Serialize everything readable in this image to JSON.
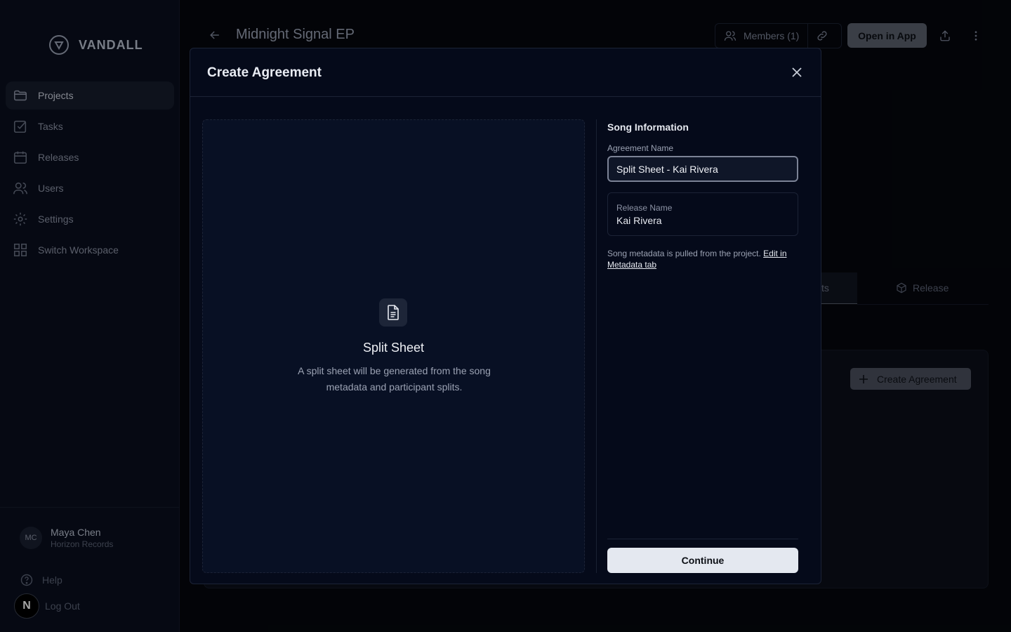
{
  "brand": {
    "name": "VANDALL",
    "logo_icon": "v-logo-icon"
  },
  "sidebar": {
    "items": [
      {
        "label": "Projects",
        "icon": "folder-icon",
        "active": true
      },
      {
        "label": "Tasks",
        "icon": "checkbox-icon",
        "active": false
      },
      {
        "label": "Releases",
        "icon": "calendar-icon",
        "active": false
      },
      {
        "label": "Users",
        "icon": "users-icon",
        "active": false
      },
      {
        "label": "Settings",
        "icon": "gear-icon",
        "active": false
      },
      {
        "label": "Switch Workspace",
        "icon": "grid-icon",
        "active": false
      }
    ],
    "user": {
      "initials": "MC",
      "name": "Maya Chen",
      "org": "Horizon Records"
    },
    "help_label": "Help",
    "logout_label": "Log Out",
    "badge_letter": "N"
  },
  "header": {
    "title": "Midnight Signal EP",
    "members_label": "Members (1)",
    "open_app_label": "Open in App"
  },
  "background": {
    "tab_partial_label": "ts",
    "tab_release_label": "Release",
    "create_agreement_label": "Create Agreement"
  },
  "modal": {
    "title": "Create Agreement",
    "preview": {
      "title": "Split Sheet",
      "description": "A split sheet will be generated from the song metadata and participant splits."
    },
    "form": {
      "section_title": "Song Information",
      "agreement_name_label": "Agreement Name",
      "agreement_name_value": "Split Sheet - Kai Rivera",
      "release_name_label": "Release Name",
      "release_name_value": "Kai Rivera",
      "help_text": "Song metadata is pulled from the project.",
      "help_link": "Edit in Metadata tab",
      "continue_label": "Continue"
    }
  },
  "colors": {
    "accent": "#e4e8f0",
    "background": "#05070d",
    "modal_bg": "#050a1a"
  }
}
